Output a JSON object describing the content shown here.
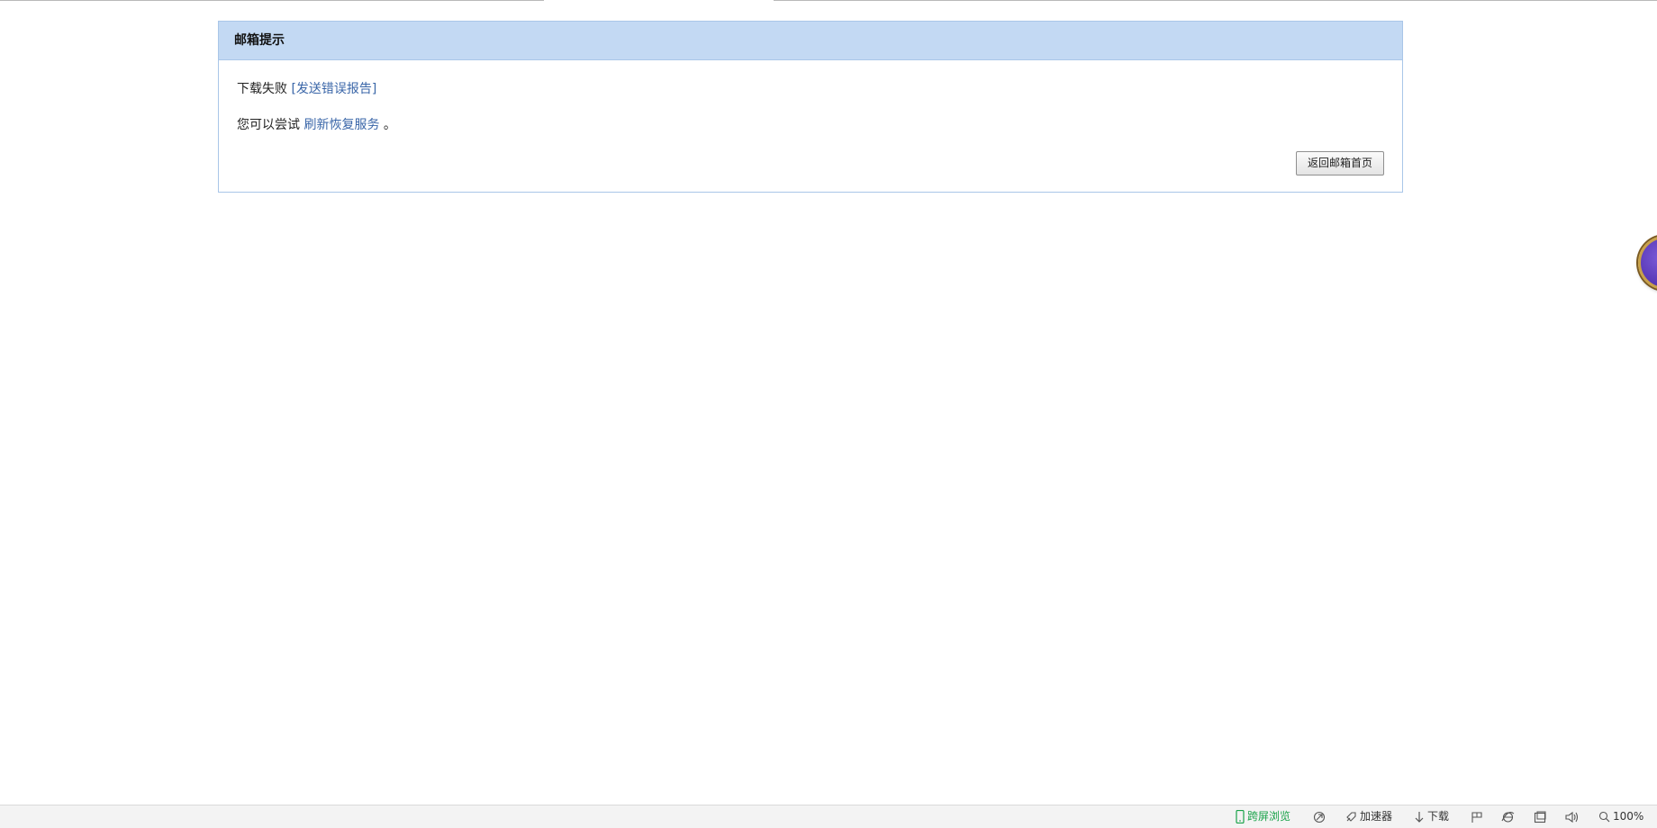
{
  "panel": {
    "title": "邮箱提示",
    "message": {
      "status": "下载失败",
      "report_link": "[发送错误报告]"
    },
    "suggestion": {
      "prefix": "您可以尝试",
      "refresh_link": "刷新恢复服务",
      "suffix": "。"
    },
    "back_button": "返回邮箱首页"
  },
  "statusbar": {
    "cross_screen": "跨屏浏览",
    "accelerator": "加速器",
    "download": "下载",
    "zoom": "100%"
  },
  "icons": {
    "cross_screen": "phone-icon",
    "cleanup": "broom-icon",
    "accelerator": "rocket-icon",
    "download": "arrow-down-icon",
    "flag": "flag-icon",
    "ie": "ie-icon",
    "window": "window-icon",
    "sound": "speaker-icon",
    "zoom": "magnifier-icon"
  },
  "colors": {
    "header_bg": "#c3d9f3",
    "border": "#a9c6e8",
    "link": "#3a66a8",
    "cross_screen": "#1aa34a"
  }
}
